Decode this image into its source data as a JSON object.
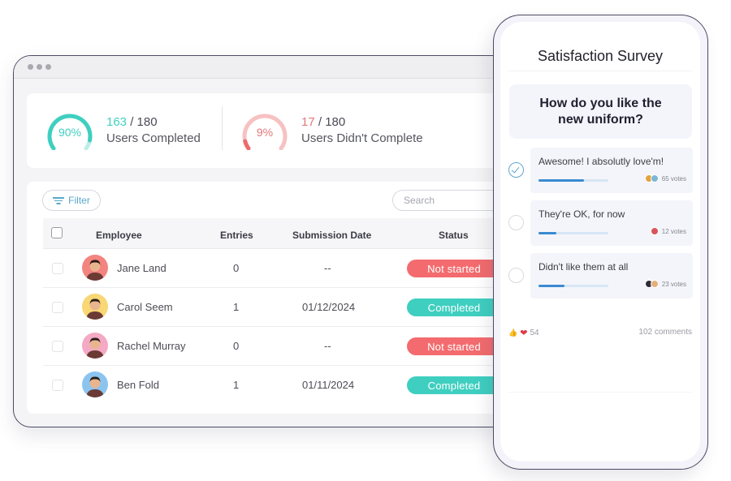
{
  "colors": {
    "teal": "#3fcfc0",
    "teal_text": "#3fcfc0",
    "red": "#f36b6e",
    "red_text": "#e0777a",
    "red_light": "#f7b2b3",
    "teal_light": "#bfeee8",
    "accent_blue": "#3a8ad0"
  },
  "browser": {
    "window_controls": [
      "dot",
      "dot",
      "dot"
    ]
  },
  "stats": [
    {
      "percent_label": "90%",
      "percent": 90,
      "count": "163",
      "total": "/ 180",
      "label": "Users Completed",
      "tone": "teal"
    },
    {
      "percent_label": "9%",
      "percent": 9,
      "count": "17",
      "total": "/ 180",
      "label": "Users Didn't Complete",
      "tone": "red"
    }
  ],
  "toolbar": {
    "filter_label": "Filter",
    "filter_icon": "filter-icon",
    "search_placeholder": "Search"
  },
  "table": {
    "columns": [
      "Employee",
      "Entries",
      "Submission Date",
      "Status"
    ],
    "rows": [
      {
        "name": "Jane Land",
        "entries": "0",
        "date": "--",
        "status": "Not started",
        "status_tone": "red",
        "avatar_bg": "#f3847f"
      },
      {
        "name": "Carol Seem",
        "entries": "1",
        "date": "01/12/2024",
        "status": "Completed",
        "status_tone": "teal",
        "avatar_bg": "#f8d774"
      },
      {
        "name": "Rachel Murray",
        "entries": "0",
        "date": "--",
        "status": "Not started",
        "status_tone": "red",
        "avatar_bg": "#f4a9c4"
      },
      {
        "name": "Ben Fold",
        "entries": "1",
        "date": "01/11/2024",
        "status": "Completed",
        "status_tone": "teal",
        "avatar_bg": "#8cc4f0"
      }
    ]
  },
  "survey": {
    "title": "Satisfaction Survey",
    "question": "How do you like the new uniform?",
    "options": [
      {
        "text": "Awesome! I absolutly love'm!",
        "votes_label": "65 votes",
        "votes": 65,
        "share": 0.65,
        "selected": true
      },
      {
        "text": "They're OK, for now",
        "votes_label": "12 votes",
        "votes": 12,
        "share": 0.25,
        "selected": false
      },
      {
        "text": "Didn't like them at all",
        "votes_label": "23 votes",
        "votes": 23,
        "share": 0.37,
        "selected": false
      }
    ],
    "reactions_count": "54",
    "comments_label": "102 comments"
  }
}
